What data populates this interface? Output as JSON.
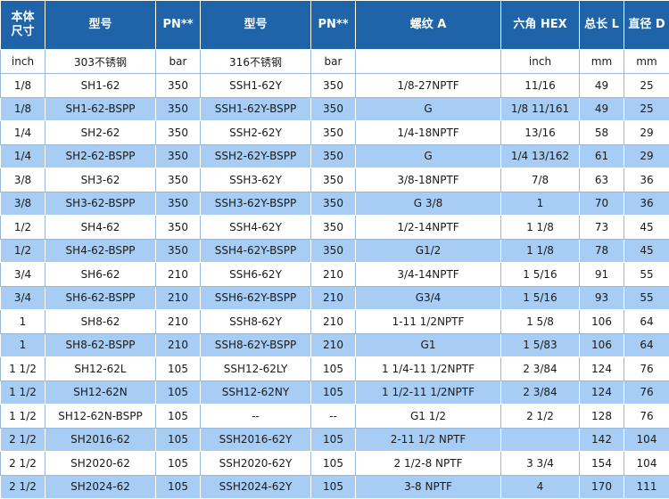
{
  "table": {
    "headers": [
      "本体\n尺寸",
      "型号",
      "PN**",
      "型号",
      "PN**",
      "螺纹 A",
      "六角 HEX",
      "总长 L",
      "直径 D"
    ],
    "units": [
      "inch",
      "303不锈钢",
      "bar",
      "316不锈钢",
      "bar",
      "",
      "inch",
      "mm",
      "mm"
    ],
    "rows": [
      [
        "1/8",
        "SH1-62",
        "350",
        "SSH1-62Y",
        "350",
        "1/8-27NPTF",
        "11/16",
        "49",
        "25"
      ],
      [
        "1/8",
        "SH1-62-BSPP",
        "350",
        "SSH1-62Y-BSPP",
        "350",
        "G",
        "1/8 11/161",
        "49",
        "25"
      ],
      [
        "1/4",
        "SH2-62",
        "350",
        "SSH2-62Y",
        "350",
        "1/4-18NPTF",
        "13/16",
        "58",
        "29"
      ],
      [
        "1/4",
        "SH2-62-BSPP",
        "350",
        "SSH2-62Y-BSPP",
        "350",
        "G",
        "1/4 13/162",
        "61",
        "29"
      ],
      [
        "3/8",
        "SH3-62",
        "350",
        "SSH3-62Y",
        "350",
        "3/8-18NPTF",
        "7/8",
        "63",
        "36"
      ],
      [
        "3/8",
        "SH3-62-BSPP",
        "350",
        "SSH3-62Y-BSPP",
        "350",
        "G 3/8",
        "1",
        "70",
        "36"
      ],
      [
        "1/2",
        "SH4-62",
        "350",
        "SSH4-62Y",
        "350",
        "1/2-14NPTF",
        "1 1/8",
        "73",
        "45"
      ],
      [
        "1/2",
        "SH4-62-BSPP",
        "350",
        "SSH4-62Y-BSPP",
        "350",
        "G1/2",
        "1 1/8",
        "78",
        "45"
      ],
      [
        "3/4",
        "SH6-62",
        "210",
        "SSH6-62Y",
        "210",
        "3/4-14NPTF",
        "1 5/16",
        "91",
        "55"
      ],
      [
        "3/4",
        "SH6-62-BSPP",
        "210",
        "SSH6-62Y-BSPP",
        "210",
        "G3/4",
        "1 5/16",
        "93",
        "55"
      ],
      [
        "1",
        "SH8-62",
        "210",
        "SSH8-62Y",
        "210",
        "1-11 1/2NPTF",
        "1 5/8",
        "106",
        "64"
      ],
      [
        "1",
        "SH8-62-BSPP",
        "210",
        "SSH8-62Y-BSPP",
        "210",
        "G1",
        "1 5/83",
        "106",
        "64"
      ],
      [
        "1 1/2",
        "SH12-62L",
        "105",
        "SSH12-62LY",
        "105",
        "1 1/4-11 1/2NPTF",
        "2 3/84",
        "124",
        "76"
      ],
      [
        "1 1/2",
        "SH12-62N",
        "105",
        "SSH12-62NY",
        "105",
        "1 1/2-11 1/2NPTF",
        "2 3/84",
        "124",
        "76"
      ],
      [
        "1 1/2",
        "SH12-62N-BSPP",
        "105",
        "--",
        "--",
        "G1 1/2",
        "2 1/2",
        "128",
        "76"
      ],
      [
        "2 1/2",
        "SH2016-62",
        "105",
        "SSH2016-62Y",
        "105",
        "2-11 1/2 NPTF",
        "",
        "142",
        "104"
      ],
      [
        "2 1/2",
        "SH2020-62",
        "105",
        "SSH2020-62Y",
        "105",
        "2 1/2-8 NPTF",
        "3 3/4",
        "154",
        "104"
      ],
      [
        "2 1/2",
        "SH2024-62",
        "105",
        "SSH2024-62Y",
        "105",
        "3-8 NPTF",
        "4",
        "170",
        "111"
      ]
    ]
  },
  "colors": {
    "header_bg": "#1f63a8",
    "header_text": "#ffffff",
    "row_alt_bg": "#a7cdf4",
    "row_bg": "#ffffff"
  }
}
